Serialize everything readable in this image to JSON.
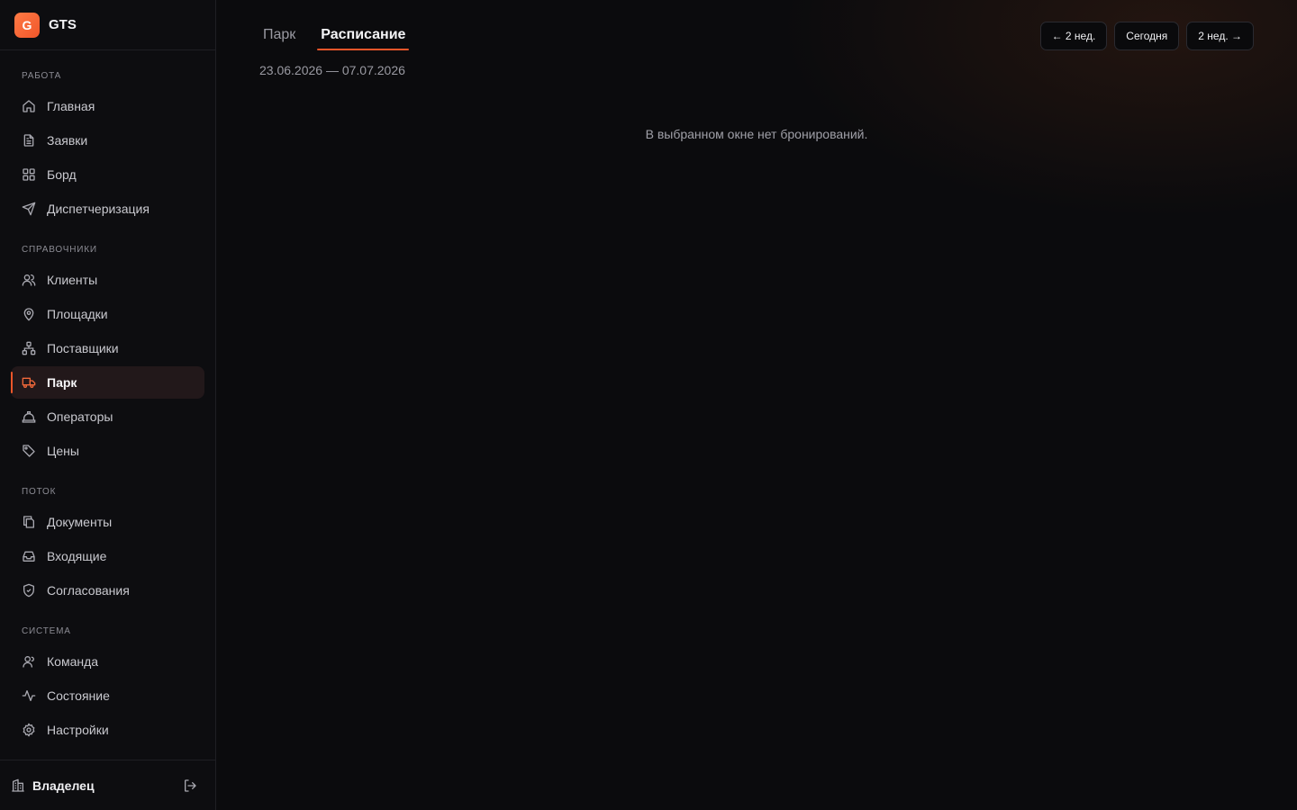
{
  "brand": {
    "logo_letter": "G",
    "name": "GTS",
    "accent": "#f0562a"
  },
  "sidebar": {
    "sections": [
      {
        "title": "РАБОТА",
        "items": [
          {
            "label": "Главная",
            "icon": "home-icon"
          },
          {
            "label": "Заявки",
            "icon": "document-icon"
          },
          {
            "label": "Борд",
            "icon": "grid-icon"
          },
          {
            "label": "Диспетчеризация",
            "icon": "send-icon"
          }
        ]
      },
      {
        "title": "СПРАВОЧНИКИ",
        "items": [
          {
            "label": "Клиенты",
            "icon": "users-icon"
          },
          {
            "label": "Площадки",
            "icon": "map-pin-icon"
          },
          {
            "label": "Поставщики",
            "icon": "network-icon"
          },
          {
            "label": "Парк",
            "icon": "truck-icon",
            "active": true
          },
          {
            "label": "Операторы",
            "icon": "hard-hat-icon"
          },
          {
            "label": "Цены",
            "icon": "tag-icon"
          }
        ]
      },
      {
        "title": "ПОТОК",
        "items": [
          {
            "label": "Документы",
            "icon": "files-icon"
          },
          {
            "label": "Входящие",
            "icon": "inbox-icon"
          },
          {
            "label": "Согласования",
            "icon": "shield-check-icon"
          }
        ]
      },
      {
        "title": "СИСТЕМА",
        "items": [
          {
            "label": "Команда",
            "icon": "user-group-icon"
          },
          {
            "label": "Состояние",
            "icon": "activity-icon"
          },
          {
            "label": "Настройки",
            "icon": "gear-icon"
          }
        ]
      }
    ],
    "footer": {
      "role": "Владелец",
      "icon": "building-icon",
      "logout_icon": "logout-icon"
    }
  },
  "main": {
    "tabs": [
      {
        "label": "Парк",
        "active": false
      },
      {
        "label": "Расписание",
        "active": true
      }
    ],
    "date_range": "23.06.2026 — 07.07.2026",
    "week_nav": {
      "prev": "← 2 нед.",
      "today": "Сегодня",
      "next": "2 нед. →"
    },
    "empty_message": "В выбранном окне нет бронирований."
  }
}
